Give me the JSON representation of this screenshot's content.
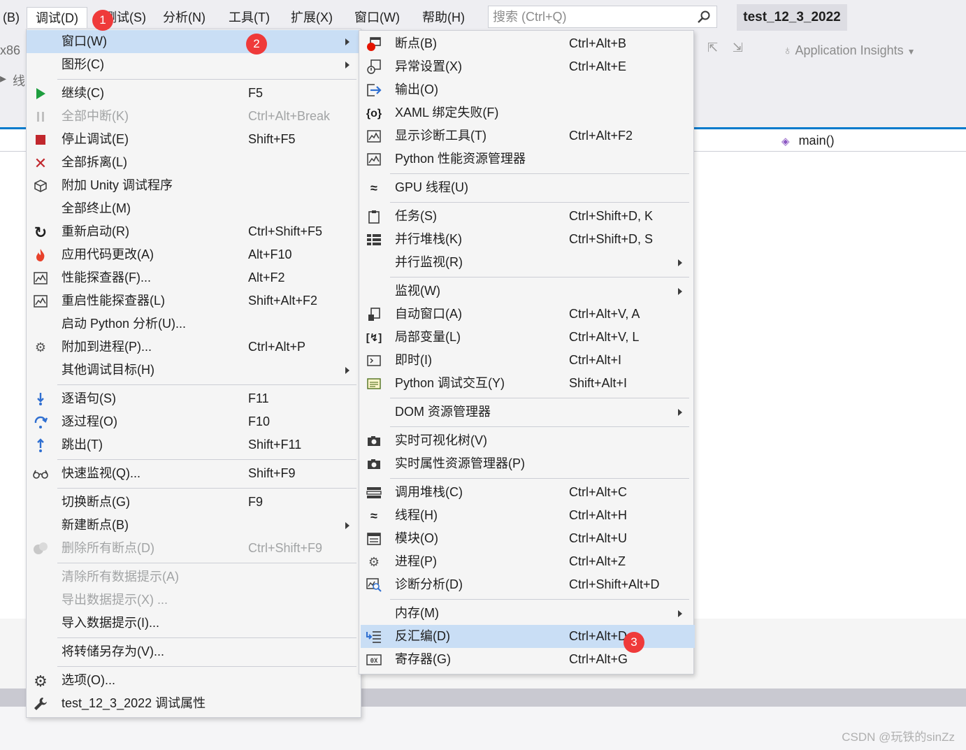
{
  "menubar": {
    "items": [
      {
        "label": "(B)"
      },
      {
        "label": "调试(D)"
      },
      {
        "label": "测试(S)"
      },
      {
        "label": "分析(N)"
      },
      {
        "label": "工具(T)"
      },
      {
        "label": "扩展(X)"
      },
      {
        "label": "窗口(W)"
      },
      {
        "label": "帮助(H)"
      }
    ],
    "search_placeholder": "搜索 (Ctrl+Q)",
    "solution_title": "test_12_3_2022"
  },
  "toolbar": {
    "platform": "x86",
    "thread_label": "线",
    "app_insights": "Application Insights"
  },
  "editor": {
    "function_combo": "main()"
  },
  "debug_menu": {
    "items": [
      {
        "label": "窗口(W)",
        "shortcut": "",
        "icon": "none",
        "state": "highlighted",
        "submenu": true
      },
      {
        "label": "图形(C)",
        "shortcut": "",
        "icon": "none",
        "state": "normal",
        "submenu": true
      },
      {
        "label": "继续(C)",
        "shortcut": "F5",
        "icon": "play-icon",
        "state": "normal"
      },
      {
        "label": "全部中断(K)",
        "shortcut": "Ctrl+Alt+Break",
        "icon": "pause-icon",
        "state": "disabled"
      },
      {
        "label": "停止调试(E)",
        "shortcut": "Shift+F5",
        "icon": "stop-icon",
        "state": "normal"
      },
      {
        "label": "全部拆离(L)",
        "shortcut": "",
        "icon": "detach-icon",
        "state": "normal"
      },
      {
        "label": "附加 Unity 调试程序",
        "shortcut": "",
        "icon": "unity-icon",
        "state": "normal"
      },
      {
        "label": "全部终止(M)",
        "shortcut": "",
        "icon": "none",
        "state": "normal"
      },
      {
        "label": "重新启动(R)",
        "shortcut": "Ctrl+Shift+F5",
        "icon": "restart-icon",
        "state": "normal"
      },
      {
        "label": "应用代码更改(A)",
        "shortcut": "Alt+F10",
        "icon": "hot-reload-icon",
        "state": "normal"
      },
      {
        "label": "性能探查器(F)...",
        "shortcut": "Alt+F2",
        "icon": "profiler-icon",
        "state": "normal"
      },
      {
        "label": "重启性能探查器(L)",
        "shortcut": "Shift+Alt+F2",
        "icon": "profiler-icon",
        "state": "normal"
      },
      {
        "label": "启动 Python 分析(U)...",
        "shortcut": "",
        "icon": "none",
        "state": "normal"
      },
      {
        "label": "附加到进程(P)...",
        "shortcut": "Ctrl+Alt+P",
        "icon": "attach-process-icon",
        "state": "normal"
      },
      {
        "label": "其他调试目标(H)",
        "shortcut": "",
        "icon": "none",
        "state": "normal",
        "submenu": true
      },
      {
        "label": "逐语句(S)",
        "shortcut": "F11",
        "icon": "step-into-icon",
        "state": "normal"
      },
      {
        "label": "逐过程(O)",
        "shortcut": "F10",
        "icon": "step-over-icon",
        "state": "normal"
      },
      {
        "label": "跳出(T)",
        "shortcut": "Shift+F11",
        "icon": "step-out-icon",
        "state": "normal"
      },
      {
        "label": "快速监视(Q)...",
        "shortcut": "Shift+F9",
        "icon": "quick-watch-icon",
        "state": "normal"
      },
      {
        "label": "切换断点(G)",
        "shortcut": "F9",
        "icon": "none",
        "state": "normal"
      },
      {
        "label": "新建断点(B)",
        "shortcut": "",
        "icon": "none",
        "state": "normal",
        "submenu": true
      },
      {
        "label": "删除所有断点(D)",
        "shortcut": "Ctrl+Shift+F9",
        "icon": "delete-breakpoints-icon",
        "state": "disabled"
      },
      {
        "label": "清除所有数据提示(A)",
        "shortcut": "",
        "icon": "none",
        "state": "disabled"
      },
      {
        "label": "导出数据提示(X) ...",
        "shortcut": "",
        "icon": "none",
        "state": "disabled"
      },
      {
        "label": "导入数据提示(I)...",
        "shortcut": "",
        "icon": "none",
        "state": "normal"
      },
      {
        "label": "将转储另存为(V)...",
        "shortcut": "",
        "icon": "none",
        "state": "normal"
      },
      {
        "label": "选项(O)...",
        "shortcut": "",
        "icon": "gear-icon",
        "state": "normal"
      },
      {
        "label": "test_12_3_2022 调试属性",
        "shortcut": "",
        "icon": "wrench-icon",
        "state": "normal"
      }
    ]
  },
  "windows_submenu": {
    "items": [
      {
        "label": "断点(B)",
        "shortcut": "Ctrl+Alt+B",
        "icon": "breakpoint-window-icon"
      },
      {
        "label": "异常设置(X)",
        "shortcut": "Ctrl+Alt+E",
        "icon": "exception-settings-icon"
      },
      {
        "label": "输出(O)",
        "shortcut": "",
        "icon": "output-icon"
      },
      {
        "label": "XAML 绑定失败(F)",
        "shortcut": "",
        "icon": "xaml-binding-icon"
      },
      {
        "label": "显示诊断工具(T)",
        "shortcut": "Ctrl+Alt+F2",
        "icon": "diagnostic-tools-icon"
      },
      {
        "label": "Python 性能资源管理器",
        "shortcut": "",
        "icon": "python-perf-icon"
      },
      {
        "label": "GPU 线程(U)",
        "shortcut": "",
        "icon": "gpu-threads-icon"
      },
      {
        "label": "任务(S)",
        "shortcut": "Ctrl+Shift+D, K",
        "icon": "tasks-icon"
      },
      {
        "label": "并行堆栈(K)",
        "shortcut": "Ctrl+Shift+D, S",
        "icon": "parallel-stacks-icon"
      },
      {
        "label": "并行监视(R)",
        "shortcut": "",
        "icon": "none",
        "submenu": true
      },
      {
        "label": "监视(W)",
        "shortcut": "",
        "icon": "none",
        "submenu": true
      },
      {
        "label": "自动窗口(A)",
        "shortcut": "Ctrl+Alt+V, A",
        "icon": "autos-icon"
      },
      {
        "label": "局部变量(L)",
        "shortcut": "Ctrl+Alt+V, L",
        "icon": "locals-icon"
      },
      {
        "label": "即时(I)",
        "shortcut": "Ctrl+Alt+I",
        "icon": "immediate-icon"
      },
      {
        "label": "Python 调试交互(Y)",
        "shortcut": "Shift+Alt+I",
        "icon": "python-interactive-icon"
      },
      {
        "label": "DOM 资源管理器",
        "shortcut": "",
        "icon": "none",
        "submenu": true
      },
      {
        "label": "实时可视化树(V)",
        "shortcut": "",
        "icon": "live-visual-tree-icon"
      },
      {
        "label": "实时属性资源管理器(P)",
        "shortcut": "",
        "icon": "live-property-icon"
      },
      {
        "label": "调用堆栈(C)",
        "shortcut": "Ctrl+Alt+C",
        "icon": "call-stack-icon"
      },
      {
        "label": "线程(H)",
        "shortcut": "Ctrl+Alt+H",
        "icon": "threads-icon"
      },
      {
        "label": "模块(O)",
        "shortcut": "Ctrl+Alt+U",
        "icon": "modules-icon"
      },
      {
        "label": "进程(P)",
        "shortcut": "Ctrl+Alt+Z",
        "icon": "processes-icon"
      },
      {
        "label": "诊断分析(D)",
        "shortcut": "Ctrl+Shift+Alt+D",
        "icon": "diagnostic-analysis-icon"
      },
      {
        "label": "内存(M)",
        "shortcut": "",
        "icon": "none",
        "submenu": true
      },
      {
        "label": "反汇编(D)",
        "shortcut": "Ctrl+Alt+D",
        "icon": "disassembly-icon",
        "state": "highlighted"
      },
      {
        "label": "寄存器(G)",
        "shortcut": "Ctrl+Alt+G",
        "icon": "registers-icon"
      }
    ]
  },
  "annotations": [
    "1",
    "2",
    "3"
  ],
  "watermark": "CSDN @玩铁的sinZz",
  "colors": {
    "accent": "#007acc",
    "highlight": "#c9def5",
    "badge": "#ef3a3a",
    "play": "#1e9e3e",
    "stop": "#c1272d"
  }
}
